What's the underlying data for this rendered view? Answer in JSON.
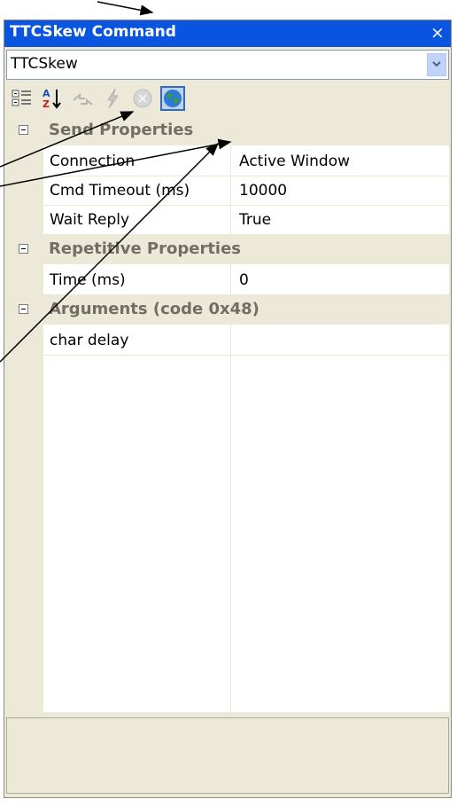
{
  "window": {
    "title": "TTCSkew Command",
    "close_glyph": "×"
  },
  "combo": {
    "selected": "TTCSkew"
  },
  "toolbar": {
    "buttons": [
      {
        "icon": "categorized-icon"
      },
      {
        "icon": "alphabetical-sort-icon"
      },
      {
        "icon": "property-pages-icon"
      },
      {
        "icon": "lightning-icon"
      },
      {
        "icon": "cancel-icon"
      },
      {
        "icon": "globe-icon"
      }
    ]
  },
  "grid": {
    "categories": [
      {
        "label": "Send Properties",
        "rows": [
          {
            "name": "Connection",
            "value": "Active Window"
          },
          {
            "name": "Cmd Timeout (ms)",
            "value": "10000"
          },
          {
            "name": "Wait Reply",
            "value": "True"
          }
        ]
      },
      {
        "label": "Repetitive Properties",
        "rows": [
          {
            "name": "Time (ms)",
            "value": "0"
          }
        ]
      },
      {
        "label": "Arguments (code 0x48)",
        "rows": [
          {
            "name": "char delay",
            "value": ""
          }
        ]
      }
    ]
  },
  "colors": {
    "titlebar": "#0a55e0",
    "panel": "#ece9d8",
    "category_text": "#716f64"
  }
}
